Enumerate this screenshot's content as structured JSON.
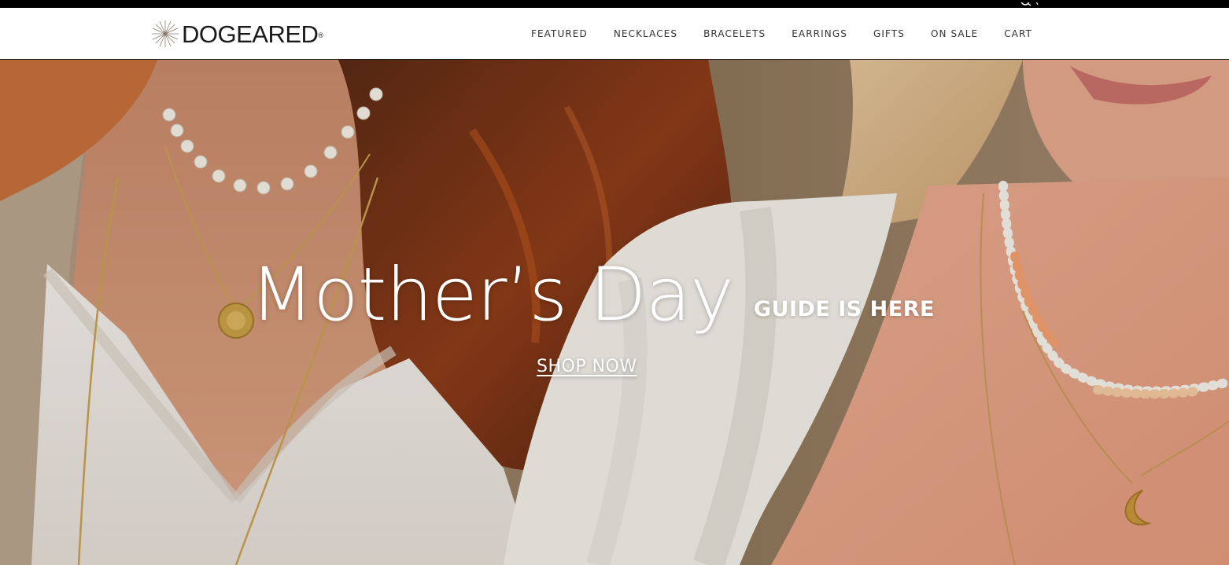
{
  "brand": {
    "logo_text": "DOGEARED",
    "registered_mark": "®"
  },
  "nav": {
    "items": [
      {
        "label": "FEATURED"
      },
      {
        "label": "NECKLACES"
      },
      {
        "label": "BRACELETS"
      },
      {
        "label": "EARRINGS"
      },
      {
        "label": "GIFTS"
      },
      {
        "label": "ON SALE"
      },
      {
        "label": "CART"
      }
    ]
  },
  "hero": {
    "title": "Mother’s Day",
    "subtitle": "GUIDE IS HERE",
    "cta_label": "SHOP NOW",
    "image_icon": "photo-two-women-wearing-necklaces"
  },
  "colors": {
    "topbar": "#000000",
    "header_bg": "#ffffff",
    "nav_text": "#333333",
    "hero_text": "#ffffff"
  },
  "icons": {
    "search": "search-icon",
    "logo_mark": "starburst-icon"
  }
}
